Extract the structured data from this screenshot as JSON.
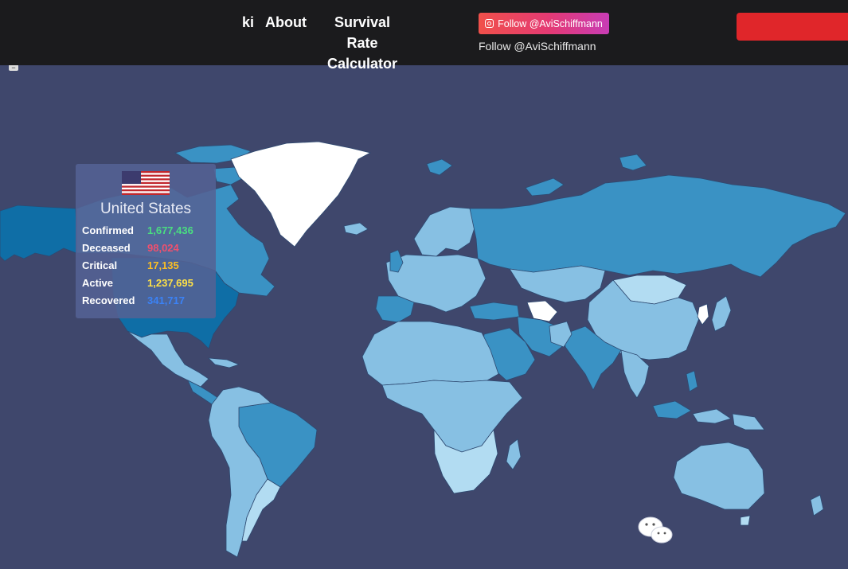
{
  "nav": {
    "ki": "ki",
    "about": "About",
    "calculator_line1": "Survival Rate",
    "calculator_line2": "Calculator"
  },
  "social": {
    "button_label": "Follow @AviSchiffmann",
    "text_link": "Follow @AviSchiffmann"
  },
  "zoom_label": "−",
  "tooltip": {
    "country": "United States",
    "rows": [
      {
        "label": "Confirmed",
        "value": "1,677,436",
        "color": "#4ade80"
      },
      {
        "label": "Deceased",
        "value": "98,024",
        "color": "#f0506e"
      },
      {
        "label": "Critical",
        "value": "17,135",
        "color": "#fbbf24"
      },
      {
        "label": "Active",
        "value": "1,237,695",
        "color": "#fde047"
      },
      {
        "label": "Recovered",
        "value": "341,717",
        "color": "#3b82f6"
      }
    ]
  },
  "colors": {
    "ocean": "#3f476c",
    "header": "#1b1b1d",
    "banner": "#e0262a",
    "choropleth_dark": "#0f6ea6",
    "choropleth_mid": "#3a92c4",
    "choropleth_light": "#87c0e3",
    "choropleth_pale": "#b2dcf2",
    "highlight": "#ffffff"
  },
  "icons": {
    "follow": "instagram-icon",
    "flag": "us-flag-icon",
    "share": "wechat-icon"
  }
}
